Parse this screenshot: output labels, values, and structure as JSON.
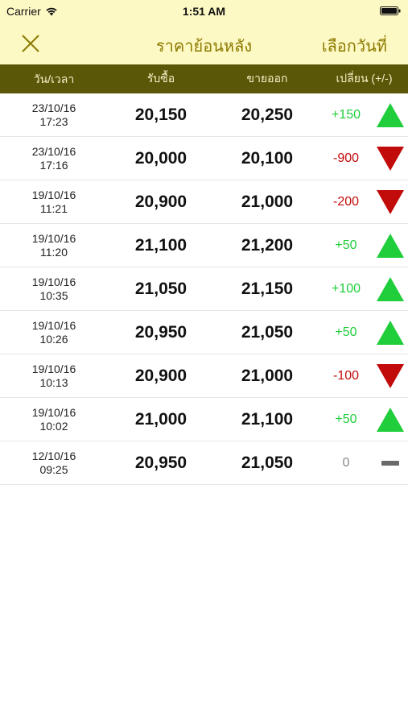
{
  "status": {
    "carrier": "Carrier",
    "time": "1:51 AM"
  },
  "nav": {
    "title": "ราคาย้อนหลัง",
    "pick_date": "เลือกวันที่"
  },
  "columns": {
    "datetime": "วัน/เวลา",
    "buy": "รับซื้อ",
    "sell": "ขายออก",
    "change": "เปลี่ยน (+/-)"
  },
  "colors": {
    "up": "#1fce3a",
    "down": "#c20c0c",
    "neutral": "#888888",
    "header_bg": "#5b5708",
    "nav_bg": "#fdf9c4",
    "accent": "#8c7a00"
  },
  "rows": [
    {
      "date": "23/10/16",
      "time": "17:23",
      "buy": "20,150",
      "sell": "20,250",
      "change": "+150",
      "trend": "up"
    },
    {
      "date": "23/10/16",
      "time": "17:16",
      "buy": "20,000",
      "sell": "20,100",
      "change": "-900",
      "trend": "down"
    },
    {
      "date": "19/10/16",
      "time": "11:21",
      "buy": "20,900",
      "sell": "21,000",
      "change": "-200",
      "trend": "down"
    },
    {
      "date": "19/10/16",
      "time": "11:20",
      "buy": "21,100",
      "sell": "21,200",
      "change": "+50",
      "trend": "up"
    },
    {
      "date": "19/10/16",
      "time": "10:35",
      "buy": "21,050",
      "sell": "21,150",
      "change": "+100",
      "trend": "up"
    },
    {
      "date": "19/10/16",
      "time": "10:26",
      "buy": "20,950",
      "sell": "21,050",
      "change": "+50",
      "trend": "up"
    },
    {
      "date": "19/10/16",
      "time": "10:13",
      "buy": "20,900",
      "sell": "21,000",
      "change": "-100",
      "trend": "down"
    },
    {
      "date": "19/10/16",
      "time": "10:02",
      "buy": "21,000",
      "sell": "21,100",
      "change": "+50",
      "trend": "up"
    },
    {
      "date": "12/10/16",
      "time": "09:25",
      "buy": "20,950",
      "sell": "21,050",
      "change": "0",
      "trend": "flat"
    }
  ]
}
